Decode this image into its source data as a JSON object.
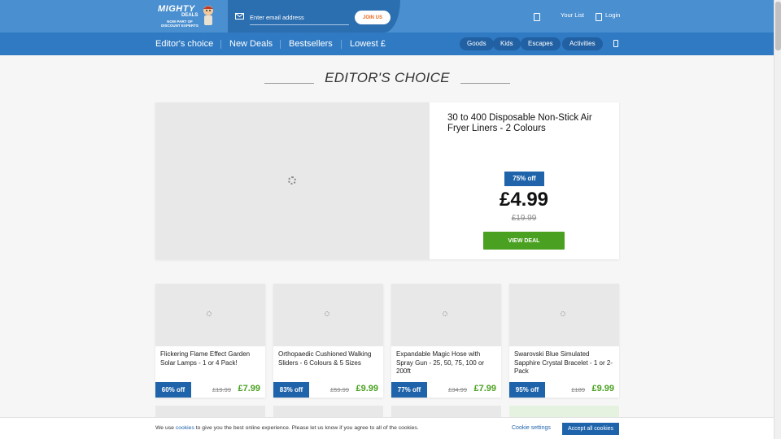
{
  "header": {
    "logo": {
      "line1": "MIGHTY",
      "line2": "DEALS",
      "line3": "NOW PART OF",
      "line4": "DISCOUNT EXPERTS"
    },
    "email": {
      "placeholder": "Enter email address",
      "join_label": "JOIN US"
    },
    "your_list": "Your List",
    "login": "Login"
  },
  "nav": {
    "links": [
      "Editor's choice",
      "New Deals",
      "Bestsellers",
      "Lowest £"
    ],
    "pills": [
      "Goods",
      "Kids",
      "Escapes",
      "Activities"
    ]
  },
  "main": {
    "heading": "EDITOR'S CHOICE",
    "featured": {
      "title": "30 to 400 Disposable Non-Stick Air Fryer Liners - 2 Colours",
      "discount": "75% off",
      "price": "£4.99",
      "was": "£19.99",
      "button": "VIEW DEAL"
    },
    "deals": [
      {
        "title": "Flickering Flame Effect Garden Solar Lamps - 1 or 4 Pack!",
        "discount": "60% off",
        "was": "£19.99",
        "price": "£7.99"
      },
      {
        "title": "Orthopaedic Cushioned Walking Sliders - 6 Colours & 5 Sizes",
        "discount": "83% off",
        "was": "£59.99",
        "price": "£9.99"
      },
      {
        "title": "Expandable Magic Hose with Spray Gun - 25, 50, 75, 100 or 200ft",
        "discount": "77% off",
        "was": "£34.99",
        "price": "£7.99"
      },
      {
        "title": "Swarovski Blue Simulated Sapphire Crystal Bracelet - 1 or 2-Pack",
        "discount": "95% off",
        "was": "£189",
        "price": "£9.99"
      }
    ]
  },
  "cookie": {
    "pre": "We use ",
    "link": "cookies",
    "post": " to give you the best online experience. Please let us know if you agree to all of the cookies.",
    "settings": "Cookie settings",
    "accept": "Accept all cookies"
  },
  "colors": {
    "header": "#4a8fd0",
    "nav": "#2f7ac3",
    "badge": "#1f64ab",
    "green": "#4aa020",
    "join": "#ea6b1f"
  }
}
